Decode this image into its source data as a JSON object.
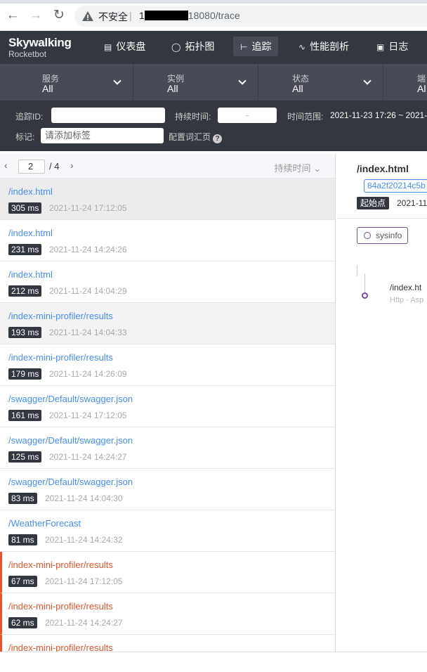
{
  "browser": {
    "security_label": "不安全",
    "url_prefix": "1",
    "url_suffix": "18080/trace"
  },
  "app": {
    "logo_line1": "Skywalking",
    "logo_line2": "Rocketbot",
    "nav": [
      {
        "label": "仪表盘",
        "icon": "dashboard-icon"
      },
      {
        "label": "拓扑图",
        "icon": "topology-icon"
      },
      {
        "label": "追踪",
        "icon": "trace-icon",
        "active": true
      },
      {
        "label": "性能剖析",
        "icon": "profile-icon"
      },
      {
        "label": "日志",
        "icon": "log-icon"
      }
    ]
  },
  "filters": [
    {
      "label": "服务",
      "value": "All"
    },
    {
      "label": "实例",
      "value": "All"
    },
    {
      "label": "状态",
      "value": "All"
    },
    {
      "label": "端",
      "value": "Al"
    }
  ],
  "search": {
    "trace_id_label": "追踪ID:",
    "trace_id_value": "",
    "duration_label": "持续时间:",
    "duration_sep": "-",
    "time_range_label": "时间范围:",
    "time_range_value": "2021-11-23 17:26 ~ 2021-1",
    "tag_label": "标记:",
    "tag_placeholder": "请添加标签",
    "config_link": "配置词汇页"
  },
  "pager": {
    "current": "2",
    "total": "/ 4",
    "sort_label": "持续时间"
  },
  "traces": [
    {
      "endpoint": "/index.html",
      "duration": "305 ms",
      "time": "2021-11-24 17:12:05",
      "state": "selected"
    },
    {
      "endpoint": "/index.html",
      "duration": "231 ms",
      "time": "2021-11-24 14:24:26",
      "state": "normal"
    },
    {
      "endpoint": "/index.html",
      "duration": "212 ms",
      "time": "2021-11-24 14:04:29",
      "state": "normal"
    },
    {
      "endpoint": "/index-mini-profiler/results",
      "duration": "193 ms",
      "time": "2021-11-24 14:04:33",
      "state": "hover"
    },
    {
      "endpoint": "/index-mini-profiler/results",
      "duration": "179 ms",
      "time": "2021-11-24 14:26:09",
      "state": "normal"
    },
    {
      "endpoint": "/swagger/Default/swagger.json",
      "duration": "161 ms",
      "time": "2021-11-24 17:12:05",
      "state": "normal"
    },
    {
      "endpoint": "/swagger/Default/swagger.json",
      "duration": "125 ms",
      "time": "2021-11-24 14:24:27",
      "state": "normal"
    },
    {
      "endpoint": "/swagger/Default/swagger.json",
      "duration": "83 ms",
      "time": "2021-11-24 14:04:30",
      "state": "normal"
    },
    {
      "endpoint": "/WeatherForecast",
      "duration": "81 ms",
      "time": "2021-11-24 14:24:32",
      "state": "normal"
    },
    {
      "endpoint": "/index-mini-profiler/results",
      "duration": "67 ms",
      "time": "2021-11-24 17:12:05",
      "state": "error"
    },
    {
      "endpoint": "/index-mini-profiler/results",
      "duration": "62 ms",
      "time": "2021-11-24 14:24:27",
      "state": "error"
    },
    {
      "endpoint": "/index-mini-profiler/results",
      "duration": "",
      "time": "",
      "state": "error"
    }
  ],
  "detail": {
    "title": "/index.html",
    "trace_id": "84a2f20214c5b",
    "start_label": "起始点",
    "start_time": "2021-11",
    "service": "sysinfo",
    "span_name": "/index.ht",
    "span_sub": "Http - Asp"
  }
}
